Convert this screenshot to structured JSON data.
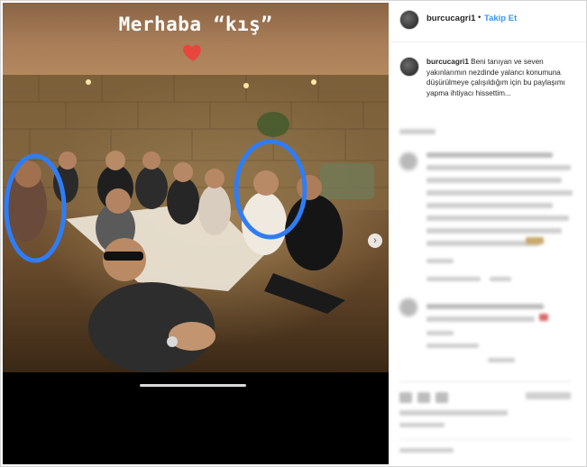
{
  "story": {
    "overlay_text": "Merhaba “kış”",
    "heart_color": "#e8453c"
  },
  "post": {
    "username": "burcucagri1",
    "separator": "•",
    "follow_label": "Takip Et",
    "follow_color": "#3897f0"
  },
  "caption": {
    "username": "burcucagri1",
    "text": "Beni tanıyan ve seven yakınlarımın nezdinde yalancı konumuna düşürülmeye çalışıldığım için bu paylaşımı yapma ihtiyacı hissettim..."
  },
  "icons": {
    "heart": "heart-icon",
    "next": "chevron-right-icon",
    "highlight": "circle-highlight"
  }
}
